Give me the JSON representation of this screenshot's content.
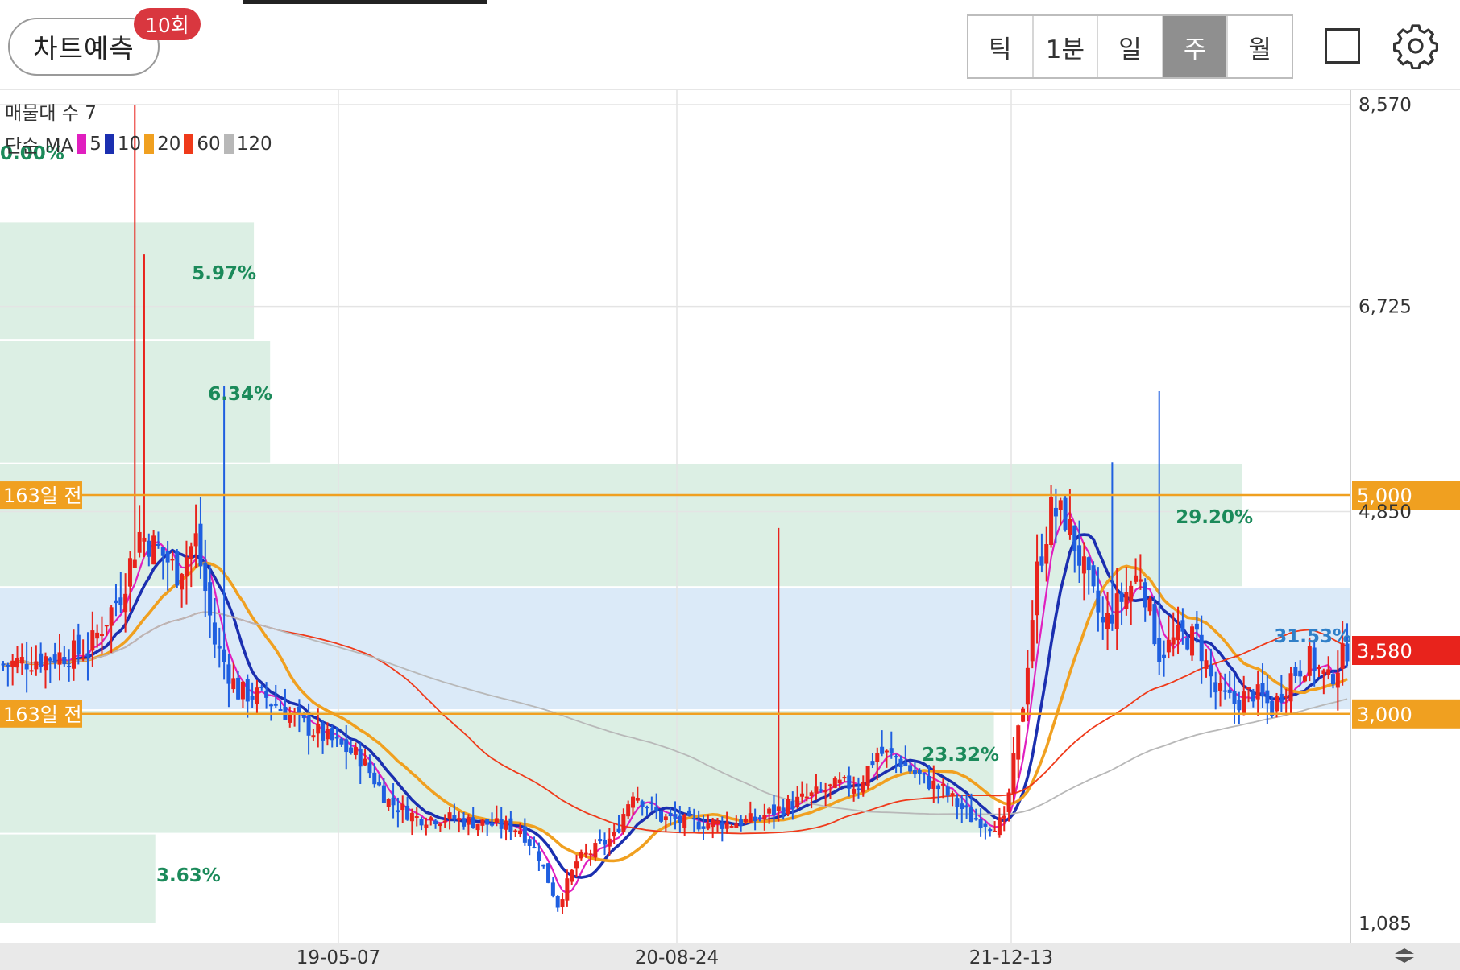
{
  "toolbar": {
    "predict_label": "차트예측",
    "predict_count": "10회",
    "periods": [
      "틱",
      "1분",
      "일",
      "주",
      "월"
    ],
    "active_period": "주"
  },
  "legend": {
    "volume_profile": "매물대 수 7",
    "ma_label": "단순 MA",
    "ma_items": [
      {
        "label": "5",
        "color": "#e01fbf"
      },
      {
        "label": "10",
        "color": "#1b2fb0"
      },
      {
        "label": "20",
        "color": "#f0a020"
      },
      {
        "label": "60",
        "color": "#ef3a1a"
      },
      {
        "label": "120",
        "color": "#b8b8b8"
      }
    ]
  },
  "colors": {
    "up": "#e8231c",
    "down": "#1f5fe0",
    "profile_green": "#dcefe4",
    "profile_blue": "#dbeaf8",
    "price_tag": "#e8231c",
    "line_tag": "#f0a020"
  },
  "chart_data": {
    "type": "candlestick",
    "period": "weekly",
    "y_axis": {
      "min": 1085,
      "max": 8570,
      "ticks": [
        "8,570",
        "6,725",
        "4,850",
        "1,085"
      ]
    },
    "x_ticks": [
      "19-05-07",
      "20-08-24",
      "21-12-13"
    ],
    "current_price": "3,580",
    "horizontal_lines": [
      {
        "label": "163일 전",
        "value": 5000,
        "value_label": "5,000"
      },
      {
        "label": "163일 전",
        "value": 3000,
        "value_label": "3,000"
      }
    ],
    "volume_profile": [
      {
        "from": 8570,
        "to": 7500,
        "pct": "0.00%"
      },
      {
        "from": 7500,
        "to": 6420,
        "pct": "5.97%"
      },
      {
        "from": 6420,
        "to": 5290,
        "pct": "6.34%"
      },
      {
        "from": 5290,
        "to": 4160,
        "pct": "29.20%"
      },
      {
        "from": 4160,
        "to": 3035,
        "pct": "31.53%"
      },
      {
        "from": 3035,
        "to": 1905,
        "pct": "23.32%"
      },
      {
        "from": 1905,
        "to": 1085,
        "pct": "3.63%"
      }
    ],
    "close_keypoints": [
      [
        0,
        3450
      ],
      [
        18,
        3580
      ],
      [
        25,
        4100
      ],
      [
        29,
        4650
      ],
      [
        33,
        4500
      ],
      [
        37,
        4300
      ],
      [
        41,
        4600
      ],
      [
        45,
        3650
      ],
      [
        50,
        3200
      ],
      [
        56,
        3150
      ],
      [
        64,
        2900
      ],
      [
        70,
        2750
      ],
      [
        76,
        2600
      ],
      [
        82,
        2200
      ],
      [
        88,
        2050
      ],
      [
        94,
        2050
      ],
      [
        102,
        2000
      ],
      [
        110,
        1950
      ],
      [
        114,
        1700
      ],
      [
        118,
        1250
      ],
      [
        122,
        1650
      ],
      [
        130,
        1880
      ],
      [
        134,
        2300
      ],
      [
        140,
        2050
      ],
      [
        146,
        2000
      ],
      [
        154,
        2000
      ],
      [
        160,
        2030
      ],
      [
        166,
        2150
      ],
      [
        172,
        2250
      ],
      [
        178,
        2350
      ],
      [
        182,
        2350
      ],
      [
        186,
        2650
      ],
      [
        190,
        2600
      ],
      [
        194,
        2450
      ],
      [
        200,
        2300
      ],
      [
        206,
        2050
      ],
      [
        210,
        2000
      ],
      [
        213,
        2000
      ],
      [
        217,
        3100
      ],
      [
        220,
        4300
      ],
      [
        223,
        4850
      ],
      [
        226,
        4800
      ],
      [
        230,
        4300
      ],
      [
        234,
        3800
      ],
      [
        238,
        4050
      ],
      [
        242,
        4300
      ],
      [
        246,
        3550
      ],
      [
        250,
        3700
      ],
      [
        254,
        3700
      ],
      [
        258,
        3200
      ],
      [
        262,
        3100
      ],
      [
        266,
        3200
      ],
      [
        270,
        3050
      ],
      [
        274,
        3350
      ],
      [
        278,
        3500
      ],
      [
        282,
        3300
      ],
      [
        286,
        3600
      ]
    ]
  }
}
